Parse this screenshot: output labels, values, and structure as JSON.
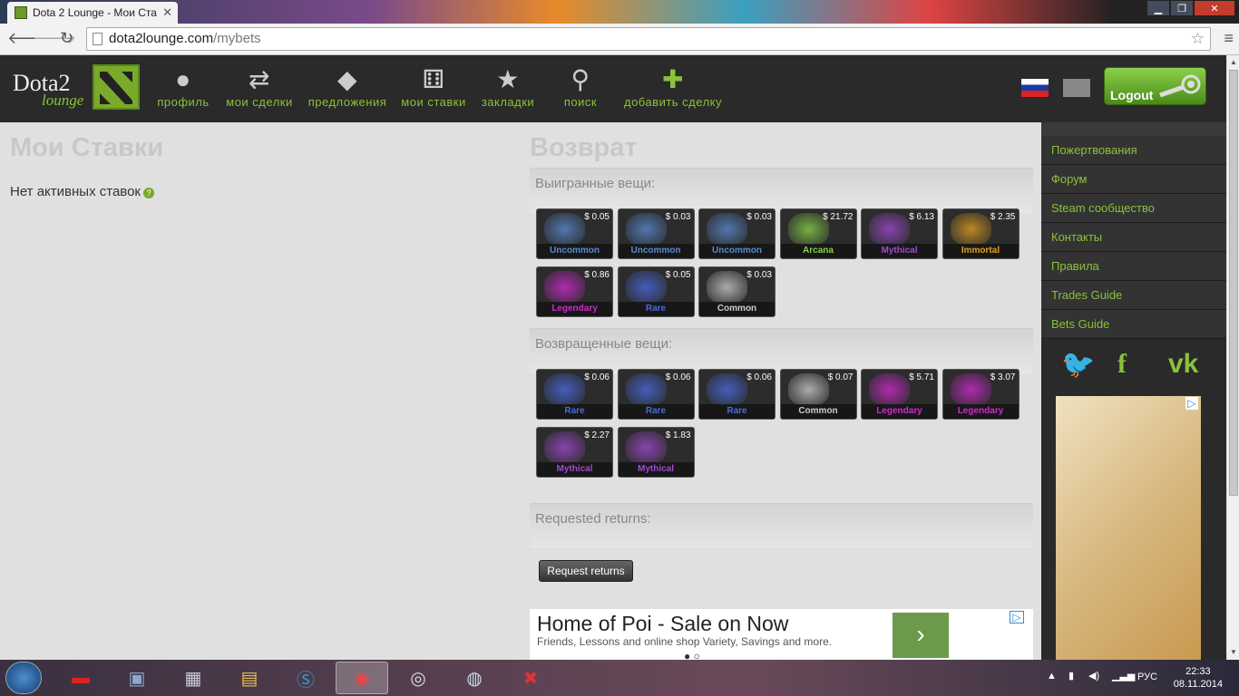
{
  "browser": {
    "tab_title": "Dota 2 Lounge - Мои Ста",
    "url_host": "dota2lounge.com",
    "url_path": "/mybets",
    "win_min": "▁",
    "win_max": "❐",
    "win_close": "✕"
  },
  "nav": {
    "logo_text1": "Dota2",
    "logo_text2": "lounge",
    "items": [
      {
        "label": "профиль",
        "icon": "user-icon"
      },
      {
        "label": "мои сделки",
        "icon": "trades-icon"
      },
      {
        "label": "предложения",
        "icon": "tag-icon"
      },
      {
        "label": "мои ставки",
        "icon": "dice-icon"
      },
      {
        "label": "закладки",
        "icon": "star-icon"
      },
      {
        "label": "поиск",
        "icon": "search-icon"
      },
      {
        "label": "добавить сделку",
        "icon": "plus-icon"
      }
    ],
    "logout_label": "Logout"
  },
  "left": {
    "title": "Мои Ставки",
    "no_active": "Нет активных ставок"
  },
  "returns": {
    "title": "Возврат",
    "won_label": "Выигранные вещи:",
    "returned_label": "Возвращенные вещи:",
    "requested_label": "Requested returns:",
    "request_button": "Request returns",
    "won_items": [
      {
        "price": "$ 0.05",
        "rarity": "Uncommon",
        "color": "#5a8ad0"
      },
      {
        "price": "$ 0.03",
        "rarity": "Uncommon",
        "color": "#5a8ad0"
      },
      {
        "price": "$ 0.03",
        "rarity": "Uncommon",
        "color": "#5a8ad0"
      },
      {
        "price": "$ 21.72",
        "rarity": "Arcana",
        "color": "#8ad04a"
      },
      {
        "price": "$ 6.13",
        "rarity": "Mythical",
        "color": "#a04ad0"
      },
      {
        "price": "$ 2.35",
        "rarity": "Immortal",
        "color": "#e0a020"
      },
      {
        "price": "$ 0.86",
        "rarity": "Legendary",
        "color": "#d02ad0"
      },
      {
        "price": "$ 0.05",
        "rarity": "Rare",
        "color": "#4a6ae0"
      },
      {
        "price": "$ 0.03",
        "rarity": "Common",
        "color": "#cccccc"
      }
    ],
    "returned_items": [
      {
        "price": "$ 0.06",
        "rarity": "Rare",
        "color": "#4a6ae0"
      },
      {
        "price": "$ 0.06",
        "rarity": "Rare",
        "color": "#4a6ae0"
      },
      {
        "price": "$ 0.06",
        "rarity": "Rare",
        "color": "#4a6ae0"
      },
      {
        "price": "$ 0.07",
        "rarity": "Common",
        "color": "#cccccc"
      },
      {
        "price": "$ 5.71",
        "rarity": "Legendary",
        "color": "#d02ad0"
      },
      {
        "price": "$ 3.07",
        "rarity": "Legendary",
        "color": "#d02ad0"
      },
      {
        "price": "$ 2.27",
        "rarity": "Mythical",
        "color": "#a04ad0"
      },
      {
        "price": "$ 1.83",
        "rarity": "Mythical",
        "color": "#a04ad0"
      }
    ]
  },
  "ad": {
    "headline": "Home of Poi - Sale on Now",
    "text": "Friends, Lessons and online shop Variety, Savings and more."
  },
  "sidebar": {
    "links": [
      "Пожертвования",
      "Форум",
      "Steam сообщество",
      "Контакты",
      "Правила",
      "Trades Guide",
      "Bets Guide"
    ]
  },
  "tray": {
    "lang": "РУС",
    "time": "22:33",
    "date": "08.11.2014"
  },
  "colors": {
    "accent": "#8ac23a",
    "header_bg": "#2a2a2a"
  }
}
